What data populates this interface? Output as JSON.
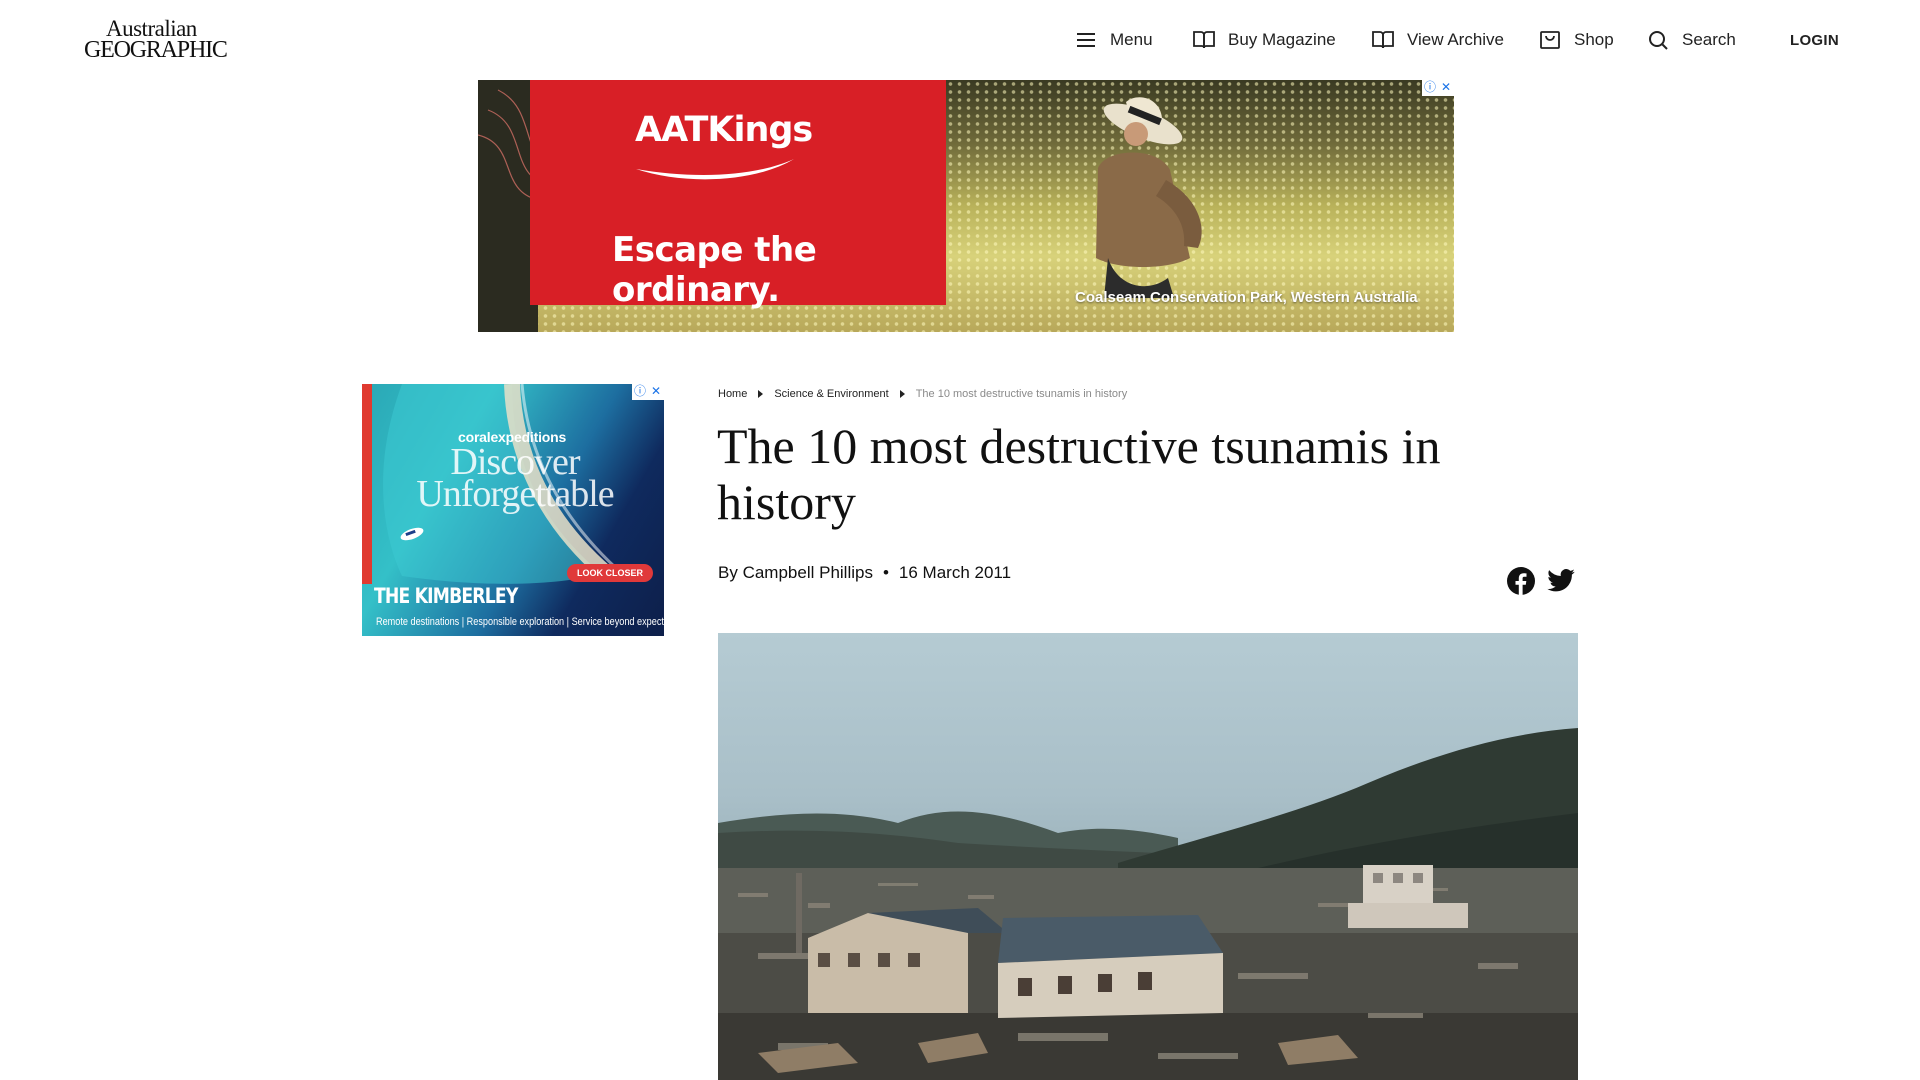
{
  "header": {
    "logo_line1": "Australian",
    "logo_line2": "GEOGRAPHIC",
    "nav": {
      "menu": "Menu",
      "buy_magazine": "Buy Magazine",
      "view_archive": "View Archive",
      "shop": "Shop",
      "search": "Search",
      "login": "LOGIN"
    }
  },
  "ad_top": {
    "brand": "AATKings",
    "tagline": "Escape the ordinary.",
    "caption": "Coalseam Conservation Park, Western Australia",
    "accent": "#d81f26"
  },
  "ad_side": {
    "brand_light": "coral",
    "brand_bold": "expeditions",
    "headline_line1": "Discover",
    "headline_line2": "Unforgettable",
    "cta": "LOOK CLOSER",
    "title": "THE KIMBERLEY",
    "subtitle": "Remote destinations | Responsible exploration | Service beyond expectation"
  },
  "article": {
    "breadcrumb": [
      "Home",
      "Science & Environment",
      "The 10 most destructive tsunamis in history"
    ],
    "title": "The 10 most destructive tsunamis in history",
    "author_prefix": "By",
    "author": "Campbell Phillips",
    "separator": "•",
    "date": "16 March 2011",
    "share": [
      "facebook-icon",
      "twitter-icon"
    ]
  }
}
